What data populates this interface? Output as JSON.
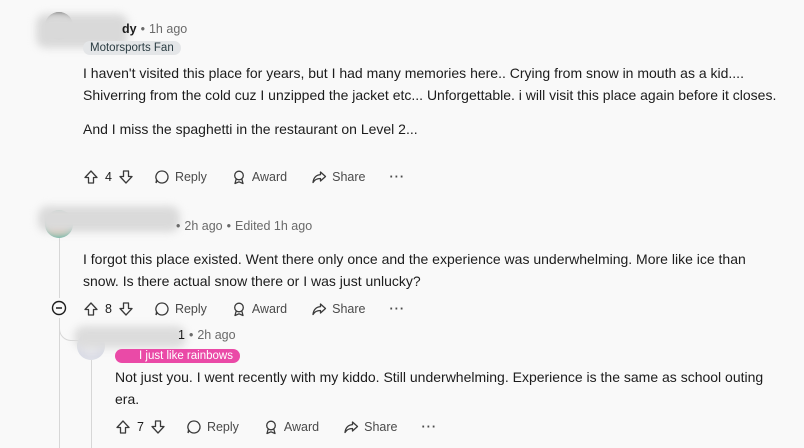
{
  "comments": [
    {
      "username": "dy",
      "time": "1h ago",
      "flair": "Motorsports Fan",
      "paragraphs": [
        "I haven't visited this place for years, but I had many memories here.. Crying from snow in mouth as a kid.... Shiverring from the cold cuz I unzipped the jacket etc... Unforgettable. i will visit this place again before it closes.",
        "And I miss the spaghetti in the restaurant on Level 2..."
      ],
      "votes": "4",
      "reply": "Reply",
      "award": "Award",
      "share": "Share",
      "more": "···"
    },
    {
      "username": "",
      "time": "2h ago",
      "edited": "Edited 1h ago",
      "paragraphs": [
        "I forgot this place existed. Went there only once and the experience was underwhelming. More like ice than snow. Is there actual snow there or I was just unlucky?"
      ],
      "votes": "8",
      "reply": "Reply",
      "award": "Award",
      "share": "Share",
      "more": "···",
      "collapse": "⊖"
    },
    {
      "username": "1",
      "time": "2h ago",
      "flair": "I just like rainbows",
      "paragraphs": [
        "Not just you. I went recently with my kiddo. Still underwhelming. Experience is the same as school outing era."
      ],
      "votes": "7",
      "reply": "Reply",
      "award": "Award",
      "share": "Share",
      "more": "···"
    }
  ],
  "colors": {
    "flair_pink": "#ea4aa7",
    "flair_grey": "#e4e6e8"
  }
}
